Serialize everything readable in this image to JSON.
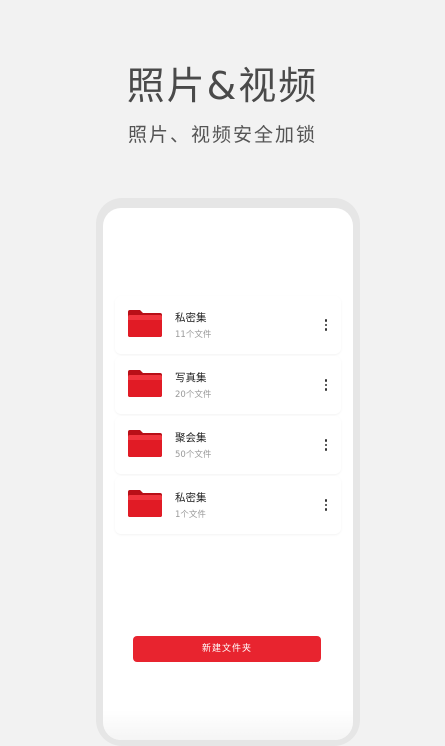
{
  "hero": {
    "title": "照片&视频",
    "subtitle": "照片、视频安全加锁"
  },
  "folders": [
    {
      "name": "私密集",
      "count": "11个文件",
      "icon": "folder-icon"
    },
    {
      "name": "写真集",
      "count": "20个文件",
      "icon": "folder-icon"
    },
    {
      "name": "聚会集",
      "count": "50个文件",
      "icon": "folder-icon"
    },
    {
      "name": "私密集",
      "count": "1个文件",
      "icon": "folder-icon"
    }
  ],
  "actions": {
    "new_folder_label": "新建文件夹"
  },
  "colors": {
    "accent": "#e8242f",
    "folder_red": "#d5121c",
    "background": "#f2f2f2"
  }
}
